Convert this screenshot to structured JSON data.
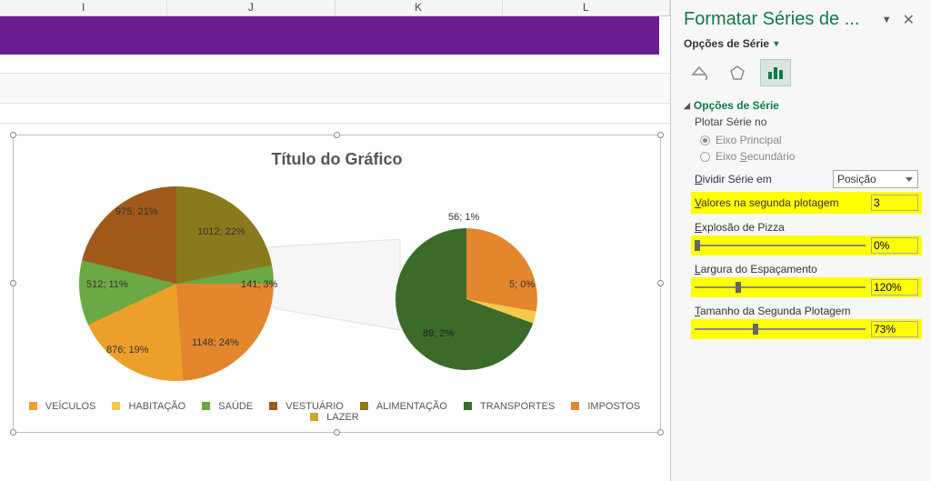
{
  "columns": [
    "I",
    "J",
    "K",
    "L"
  ],
  "chart": {
    "title": "Título do Gráfico"
  },
  "chart_data": {
    "type": "pie",
    "title": "Título do Gráfico",
    "split_into_second_plot": 3,
    "series": [
      {
        "name": "VEÍCULOS",
        "value": 876,
        "pct": 19,
        "color": "#ed9f2b",
        "plot": "primary",
        "label": "876; 19%"
      },
      {
        "name": "HABITAÇÃO",
        "value": 512,
        "pct": 11,
        "color": "#6aa944",
        "plot": "primary",
        "label": "512; 11%"
      },
      {
        "name": "SAÚDE",
        "value": 975,
        "pct": 21,
        "color": "#a0591a",
        "plot": "primary",
        "label": "975; 21%"
      },
      {
        "name": "VESTUÁRIO",
        "value": 1012,
        "pct": 22,
        "color": "#8a7a1e",
        "plot": "primary",
        "label": "1012; 22%"
      },
      {
        "name": "ALIMENTAÇÃO",
        "value": 1148,
        "pct": 24,
        "color": "#e3862d",
        "plot": "primary",
        "label": "1148; 24%"
      },
      {
        "name": "TRANSPORTES",
        "value": 141,
        "pct": 3,
        "color": "#3b6b29",
        "plot": "secondary",
        "label": "141; 3%",
        "label2": "89; 2%"
      },
      {
        "name": "IMPOSTOS",
        "value": 56,
        "pct": 1,
        "color": "#e3862d",
        "plot": "secondary",
        "label": "56; 1%"
      },
      {
        "name": "LAZER",
        "value": 5,
        "pct": 0,
        "color": "#f2c94c",
        "plot": "secondary",
        "label": "5; 0%"
      }
    ]
  },
  "legend": {
    "items": [
      "VEÍCULOS",
      "HABITAÇÃO",
      "SAÚDE",
      "VESTUÁRIO",
      "ALIMENTAÇÃO",
      "TRANSPORTES",
      "IMPOSTOS",
      "LAZER"
    ],
    "colors": [
      "#ed9f2b",
      "#f2c94c",
      "#6aa944",
      "#a0591a",
      "#8a7a1e",
      "#3b6b29",
      "#e3862d",
      "#c7a83a"
    ]
  },
  "pane": {
    "title": "Formatar Séries de ...",
    "subtitle": "Opções de Série",
    "section": "Opções de Série",
    "plot_on": "Plotar Série no",
    "axis_primary": "Eixo Principal",
    "axis_secondary": "Eixo Secundário",
    "split_label": "Dividir Série em",
    "split_value": "Posição",
    "values_2nd_label": "Valores na segunda plotagem",
    "values_2nd": "3",
    "explosion_label": "Explosão de Pizza",
    "explosion": "0%",
    "gap_label": "Largura do Espaçamento",
    "gap": "120%",
    "size2_label": "Tamanho da Segunda Plotagem",
    "size2": "73%"
  }
}
